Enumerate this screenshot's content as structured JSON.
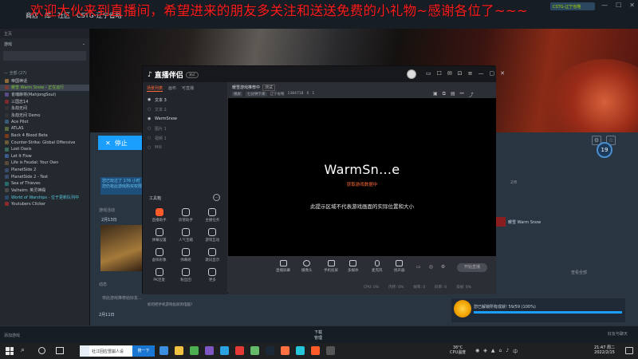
{
  "overlay_message": "欢迎大伙来到直播间，希望进来的朋友多关注和送送免费的小礼物~感谢各位了~~~",
  "steam": {
    "nav": [
      "商店",
      "库",
      "社区",
      "CSTG-辽宁省略"
    ],
    "user": "CSTG-辽宁省略",
    "sidebar": {
      "home": "主页",
      "games_label": "游戏",
      "all_label": "— 全部 (27)",
      "items": [
        {
          "label": "帝国神话",
          "color": "#8b6b3a"
        },
        {
          "label": "暖雪 Warm Snow - 正在运行",
          "color": "#7a3b3b",
          "active": true
        },
        {
          "label": "雀魂麻将(MahjongSoul)",
          "color": "#5b4a8a"
        },
        {
          "label": "三国志14",
          "color": "#7a2a2a"
        },
        {
          "label": "永劫无间",
          "color": "#333"
        },
        {
          "label": "永劫无间 Demo",
          "color": "#333"
        },
        {
          "label": "Ace Pilot",
          "color": "#3a5a7a"
        },
        {
          "label": "ATLAS",
          "color": "#5a6a3a"
        },
        {
          "label": "Back 4 Blood Beta",
          "color": "#7a3a1a"
        },
        {
          "label": "Counter-Strike: Global Offensive",
          "color": "#6a5a3a"
        },
        {
          "label": "Lost Oasis",
          "color": "#3a6a5a"
        },
        {
          "label": "Let It Flow",
          "color": "#3a5a8a"
        },
        {
          "label": "Life is Feudal: Your Own",
          "color": "#5a4a3a"
        },
        {
          "label": "PlanetSide 2",
          "color": "#3a4a6a"
        },
        {
          "label": "PlanetSide 2 - Test",
          "color": "#3a4a6a"
        },
        {
          "label": "Sea of Thieves",
          "color": "#2a6a6a"
        },
        {
          "label": "Valheim: 英灵神殿",
          "color": "#4a4a4a"
        },
        {
          "label": "World of Warships - 位于更新队列中",
          "color": "#2a4a6a",
          "update": true
        },
        {
          "label": "Youtubers Clicker",
          "color": "#8a2a2a"
        }
      ]
    },
    "stop_button": "停止",
    "notice": "您已玩过了 176 小时 您仍有此游戏购买权限",
    "activity_label": "游戏活动",
    "activity_date": "2月13日",
    "dynamic_label": "动态",
    "friend_note": "将此游戏推荐给好友...",
    "date2": "2月11日",
    "level": "19",
    "friend_item": "暖雪 Warm Snow",
    "view_all": "查看全部",
    "count_label": "2/8",
    "download_text": "您已解锁所有成就! 59/59 (100%)",
    "add_game": "添加游戏",
    "downloads_label": "下载",
    "downloads_sub": "管理",
    "friends_chat": "好友与聊天"
  },
  "app": {
    "title": "直播伴侣",
    "badge": "测试",
    "scene_tabs": [
      "场景列表",
      "画布",
      "可直播"
    ],
    "scenes": [
      {
        "label": "文本 3",
        "on": true
      },
      {
        "label": "文本 2",
        "on": false
      },
      {
        "label": "WarmSnow",
        "on": true
      },
      {
        "label": "图片 1",
        "on": false
      },
      {
        "label": "视频 1",
        "on": false
      },
      {
        "label": "MIX",
        "on": false
      }
    ],
    "tools_label": "工具箱",
    "tools": [
      {
        "label": "直播助手",
        "hot": true
      },
      {
        "label": "房管助手",
        "hot": false
      },
      {
        "label": "主播任务",
        "hot": false
      },
      {
        "label": "弹幕设置",
        "hot": false
      },
      {
        "label": "人气宝箱",
        "hot": false
      },
      {
        "label": "游戏互动",
        "hot": false
      },
      {
        "label": "虚拟形象",
        "hot": false
      },
      {
        "label": "弹幕姬",
        "hot": false
      },
      {
        "label": "歌词显示",
        "hot": false
      },
      {
        "label": "PK连麦",
        "hot": false
      },
      {
        "label": "粉丝团",
        "hot": false
      },
      {
        "label": "更多",
        "hot": false
      }
    ],
    "bottom_check": "如何把手机游戏投屏到电脑?",
    "stage_title": "暖雪游戏推荐中",
    "stage_tag": "测试",
    "stage_info": [
      "横屏",
      "七分钟下来",
      "辽宁省略",
      "1384718",
      "6",
      "1"
    ],
    "preview_name": "WarmSn...e",
    "preview_sub": "获取游戏数据中",
    "preview_hint": "此提示区域不代表游戏画面的实际位置和大小",
    "controls": [
      "直播屏幕",
      "摄像头",
      "手机投屏",
      "多媒体",
      "麦克风",
      "扬声器"
    ],
    "start_live": "开始直播",
    "status": [
      "CPU: 0%",
      "内存: 0%",
      "帧率: 0",
      "码率: 0",
      "丢帧: 0%"
    ]
  },
  "taskbar": {
    "search_text": "社江回应雪崩人设",
    "search_button": "搜一下",
    "weather_temp": "36°C",
    "weather_desc": "CPU温度",
    "time": "21:47 周二",
    "date": "2022/2/15"
  },
  "colors": {
    "overlay_red": "#ff1e1e",
    "accent_orange": "#ff6a3a",
    "steam_blue": "#1a9fff"
  }
}
